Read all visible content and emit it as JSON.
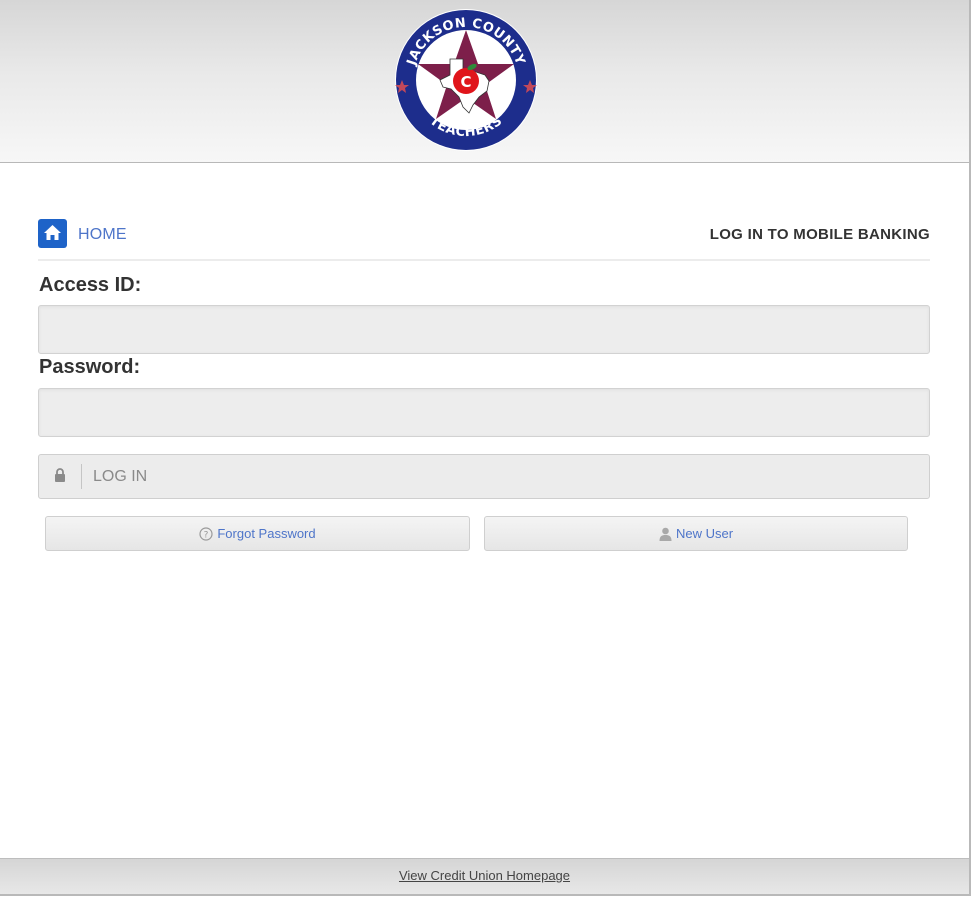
{
  "header": {
    "logo": {
      "ring_text_top": "JACKSON COUNTY",
      "ring_text_bottom": "TEACHERS",
      "center_letter": "C",
      "colors": {
        "ring": "#1d2d8c",
        "star": "#7d1f4a",
        "apple": "#e0151b"
      }
    }
  },
  "nav": {
    "home_label": "HOME",
    "page_heading": "LOG IN TO MOBILE BANKING"
  },
  "form": {
    "access_id_label": "Access ID:",
    "access_id_value": "",
    "password_label": "Password:",
    "password_value": "",
    "login_label": "LOG IN"
  },
  "actions": {
    "forgot_password": "Forgot Password",
    "new_user": "New User"
  },
  "footer": {
    "link_label": "View Credit Union Homepage"
  },
  "theme": {
    "accent": "#1e63c8",
    "link": "#4e75c9"
  },
  "icons": {
    "home": "home-icon",
    "lock": "lock-icon",
    "help": "question-circle-icon",
    "user": "user-icon"
  }
}
